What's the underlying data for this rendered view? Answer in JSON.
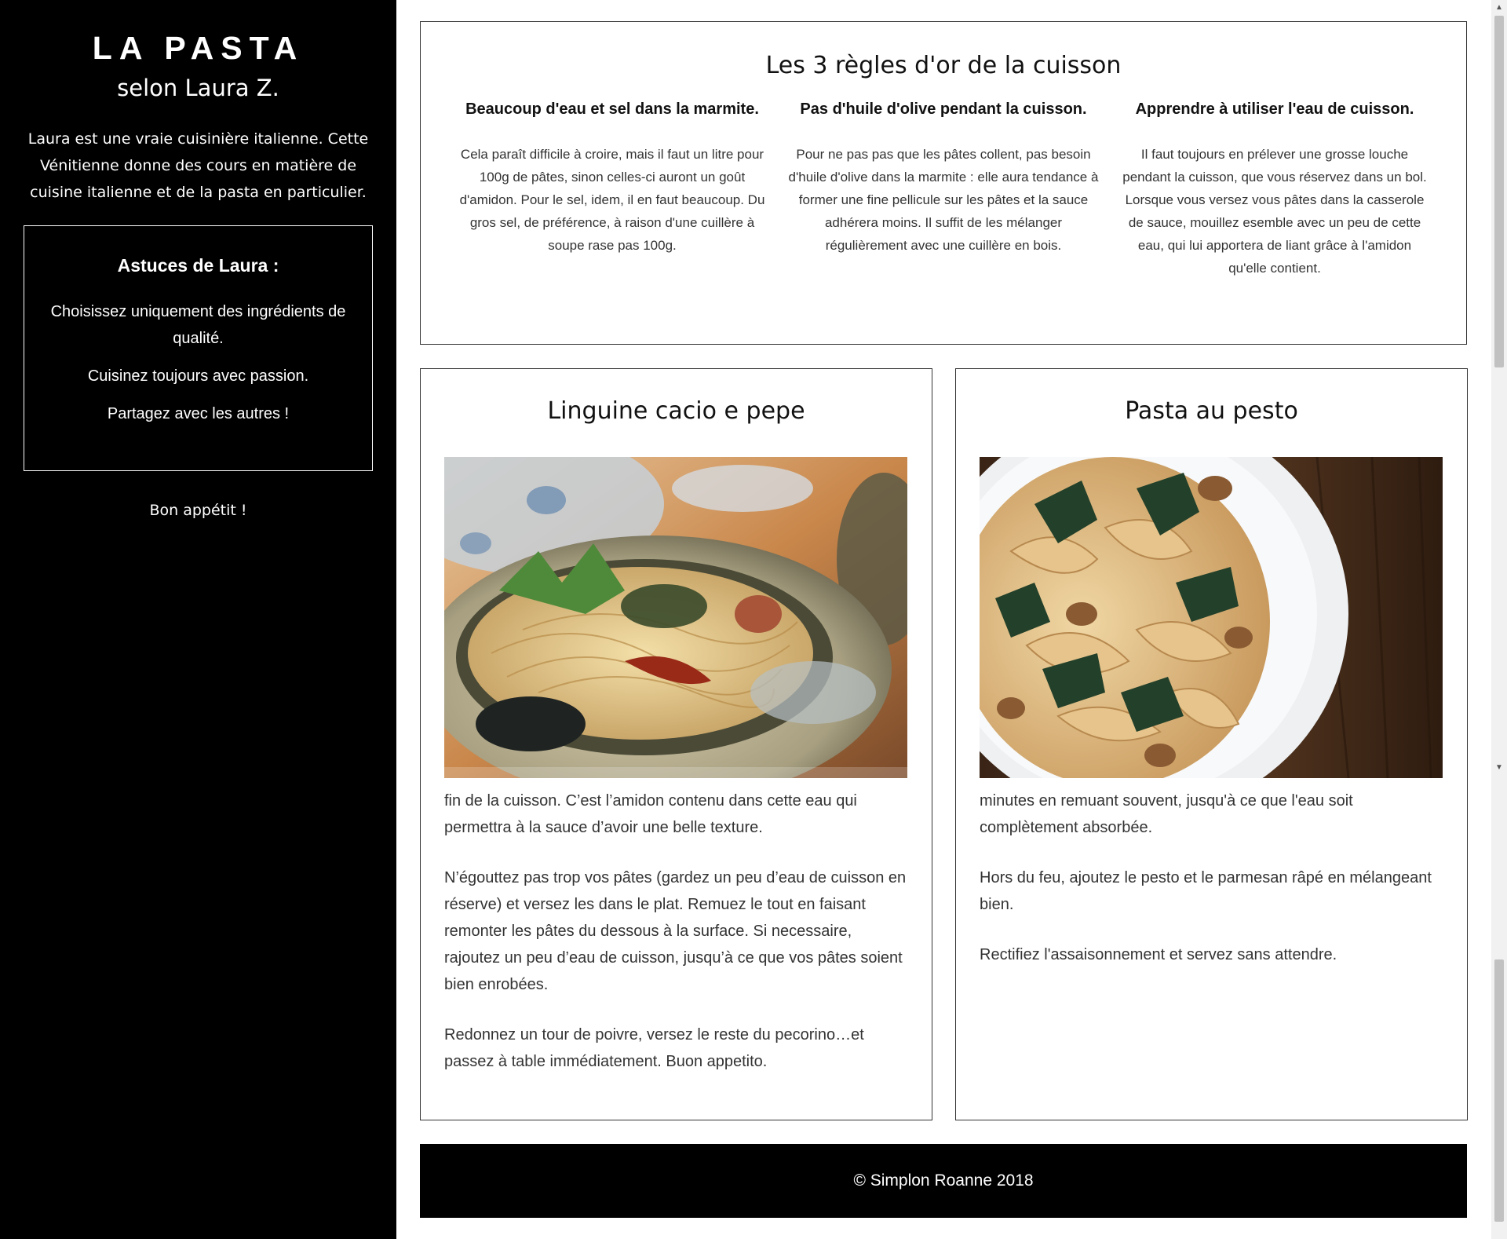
{
  "sidebar": {
    "brand": "LA PASTA",
    "subtitle": "selon Laura Z.",
    "intro": "Laura est une vraie cuisinière italienne. Cette Vénitienne donne des cours en matière de cuisine italienne et de la pasta en particulier.",
    "tips": {
      "title": "Astuces de Laura :",
      "items": [
        "Choisissez uniquement des ingrédients de qualité.",
        "Cuisinez toujours avec passion.",
        "Partagez avec les autres !"
      ]
    },
    "signoff": "Bon appétit !"
  },
  "rules": {
    "title": "Les 3 règles d'or de la cuisson",
    "columns": [
      {
        "heading": "Beaucoup d'eau et sel dans la marmite.",
        "text": "Cela paraît difficile à croire, mais il faut un litre pour 100g de pâtes, sinon celles-ci auront un goût d'amidon. Pour le sel, idem, il en faut beaucoup. Du gros sel, de préférence, à raison d'une cuillère à soupe rase pas 100g."
      },
      {
        "heading": "Pas d'huile d'olive pendant la cuisson.",
        "text": "Pour ne pas pas que les pâtes collent, pas besoin d'huile d'olive dans la marmite : elle aura tendance à former une fine pellicule sur les pâtes et la sauce adhérera moins. Il suffit de les mélanger régulièrement avec une cuillère en bois."
      },
      {
        "heading": "Apprendre à utiliser l'eau de cuisson.",
        "text": "Il faut toujours en prélever une grosse louche pendant la cuisson, que vous réservez dans un bol. Lorsque vous versez vous pâtes dans la casserole de sauce, mouillez esemble avec un peu de cette eau, qui lui apportera de liant grâce à l'amidon qu'elle contient."
      }
    ]
  },
  "recipes": [
    {
      "title": "Linguine cacio e pepe",
      "paragraphs": [
        "fin de la cuisson. C’est l’amidon contenu dans cette eau qui permettra à la sauce d’avoir une belle texture.",
        "N’égouttez pas trop vos pâtes (gardez un peu d’eau de cuisson en réserve) et versez les dans le plat. Remuez le tout en faisant remonter les pâtes du dessous à la surface. Si necessaire, rajoutez un peu d’eau de cuisson, jusqu’à ce que vos pâtes soient bien enrobées.",
        "Redonnez un tour de poivre, versez le reste du pecorino…et passez à table immédiatement. Buon appetito."
      ]
    },
    {
      "title": "Pasta au pesto",
      "paragraphs": [
        "minutes en remuant souvent, jusqu'à ce que l'eau soit complètement absorbée.",
        "Hors du feu, ajoutez le pesto et le parmesan râpé en mélangeant bien.",
        "Rectifiez l'assaisonnement et servez sans attendre."
      ]
    }
  ],
  "footer": {
    "text": "© Simplon Roanne 2018"
  },
  "colors": {
    "sidebar_bg": "#000000",
    "sidebar_text": "#ffffff",
    "footer_bg": "#000000",
    "border": "#333333"
  }
}
